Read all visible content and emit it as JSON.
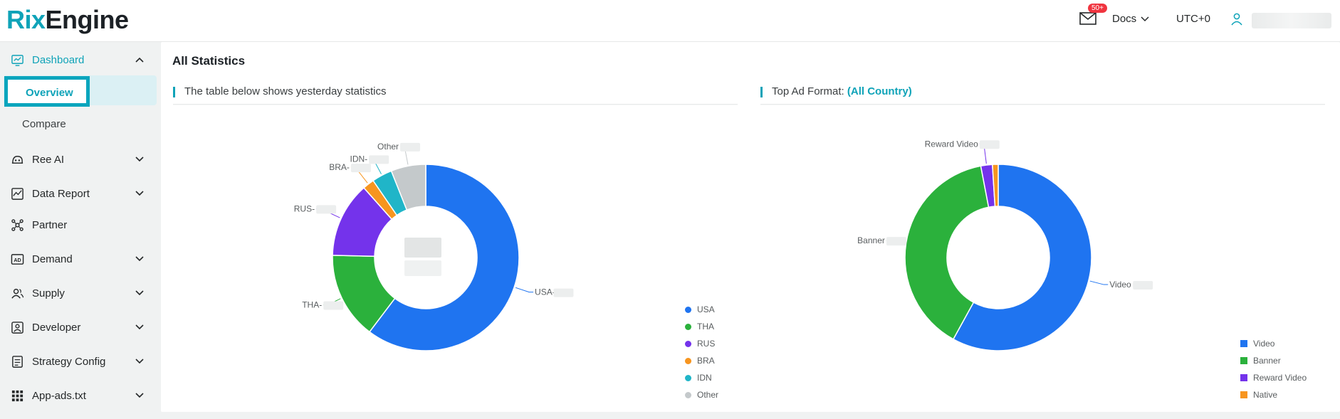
{
  "header": {
    "logo_part1": "Rix",
    "logo_part2": "Engine",
    "mail_badge": "50+",
    "docs_label": "Docs",
    "timezone": "UTC+0"
  },
  "sidebar": {
    "items": [
      {
        "label": "Dashboard",
        "icon": "dashboard-icon"
      },
      {
        "label": "Ree AI",
        "icon": "ai-icon"
      },
      {
        "label": "Data Report",
        "icon": "report-icon"
      },
      {
        "label": "Partner",
        "icon": "partner-icon"
      },
      {
        "label": "Demand",
        "icon": "ad-icon"
      },
      {
        "label": "Supply",
        "icon": "users-icon"
      },
      {
        "label": "Developer",
        "icon": "developer-icon"
      },
      {
        "label": "Strategy Config",
        "icon": "strategy-icon"
      },
      {
        "label": "App-ads.txt",
        "icon": "grid-icon"
      }
    ],
    "subitems": [
      "Overview",
      "Compare"
    ]
  },
  "main": {
    "title": "All Statistics",
    "left_panel_title": "The table below shows yesterday statistics",
    "right_panel_title": "Top Ad Format:",
    "right_panel_highlight": "(All Country)"
  },
  "colors": {
    "accent": "#0fa3b8",
    "blue": "#1f74f0",
    "green": "#2bb13c",
    "purple": "#7433eb",
    "orange": "#f7951f",
    "teal": "#20b5c8",
    "gray": "#c4c9cb"
  },
  "chart_data": [
    {
      "type": "pie",
      "categories": [
        "USA",
        "THA",
        "RUS",
        "BRA",
        "IDN",
        "Other"
      ],
      "values": [
        60,
        15,
        13,
        2,
        3.5,
        6
      ],
      "slice_labels": [
        "USA-",
        "THA-",
        "RUS-",
        "BRA-",
        "IDN-",
        "Other"
      ],
      "legend_placement": "bottom-right"
    },
    {
      "type": "pie",
      "categories": [
        "Video",
        "Banner",
        "Reward Video",
        "Native"
      ],
      "values": [
        58,
        39,
        2,
        1
      ],
      "slice_labels": [
        "Video",
        "Banner",
        "Reward Video",
        ""
      ],
      "legend_placement": "bottom-right"
    }
  ]
}
